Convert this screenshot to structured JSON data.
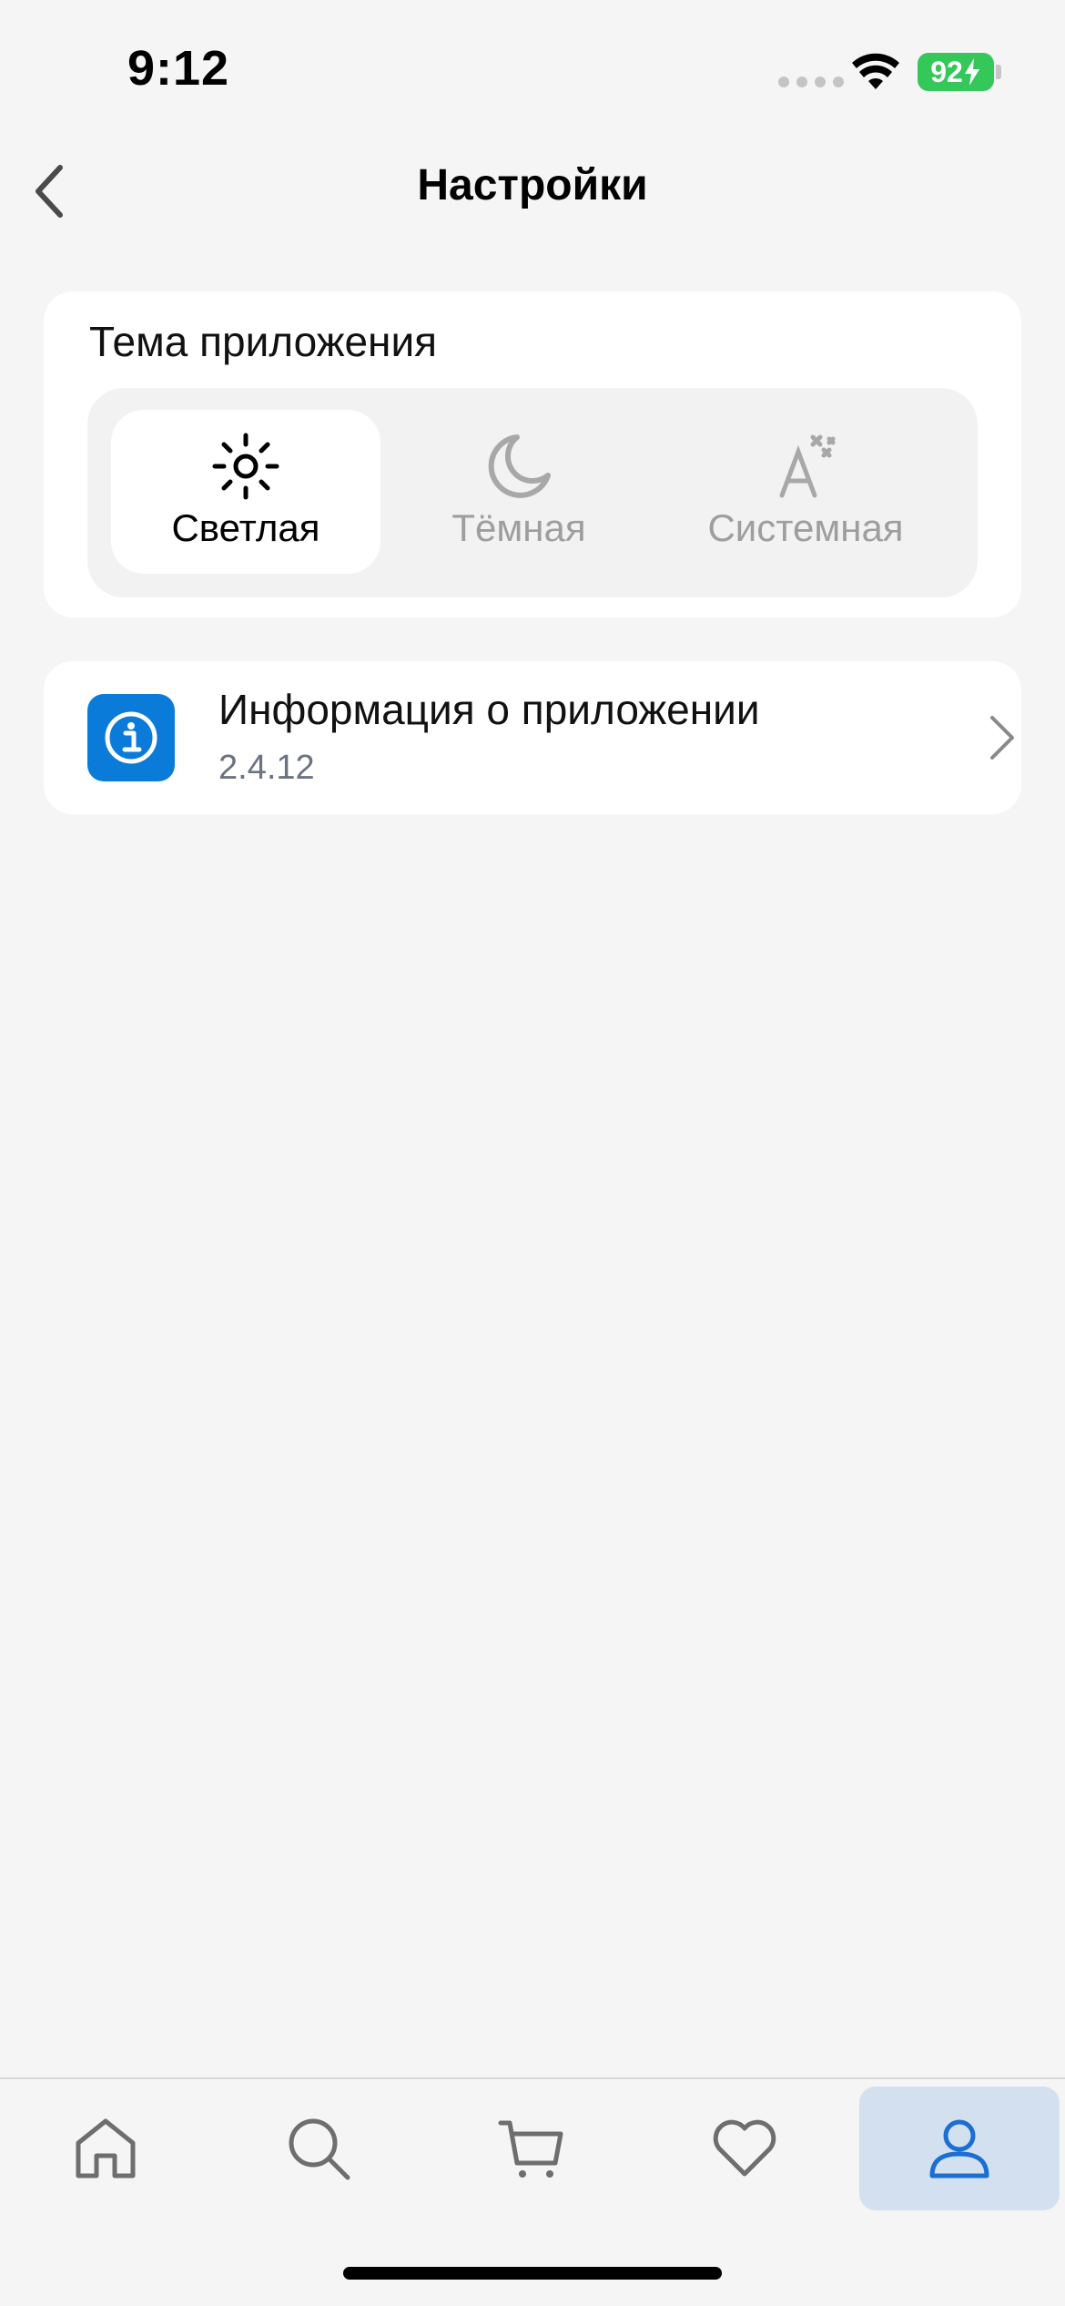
{
  "status_bar": {
    "time": "9:12",
    "battery_percent": "92",
    "battery_color": "#34c759"
  },
  "nav": {
    "title": "Настройки",
    "back_icon": "chevron-left-icon"
  },
  "theme": {
    "title": "Тема приложения",
    "options": [
      {
        "label": "Светлая",
        "icon": "sun-icon",
        "selected": true
      },
      {
        "label": "Тёмная",
        "icon": "moon-icon",
        "selected": false
      },
      {
        "label": "Системная",
        "icon": "auto-theme-icon",
        "selected": false
      }
    ],
    "selected_text_color": "#000000",
    "unselected_text_color": "#9e9e9e"
  },
  "app_info": {
    "title": "Информация о приложении",
    "version": "2.4.12",
    "icon": "info-icon",
    "icon_bg_color": "#0b7bd9"
  },
  "tab_bar": {
    "active_color": "#1a6fd1",
    "inactive_color": "#6e6e6e",
    "items": [
      {
        "icon": "home-icon",
        "active": false
      },
      {
        "icon": "search-icon",
        "active": false
      },
      {
        "icon": "cart-icon",
        "active": false
      },
      {
        "icon": "heart-icon",
        "active": false
      },
      {
        "icon": "profile-icon",
        "active": true
      }
    ]
  }
}
